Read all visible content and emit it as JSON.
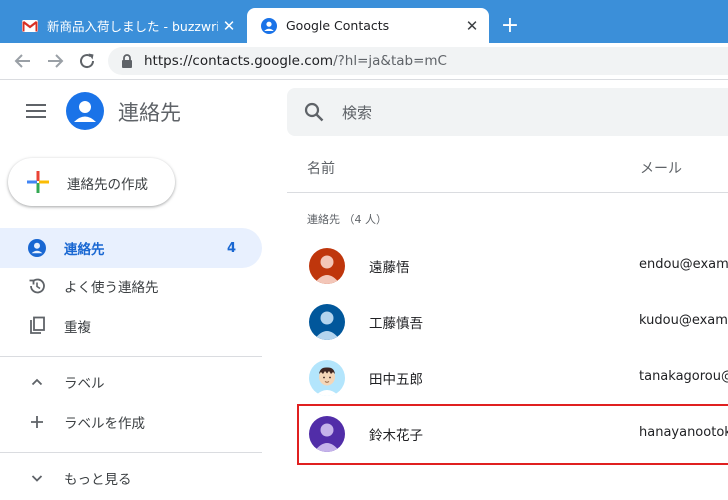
{
  "browser": {
    "tabs": [
      {
        "title": "新商品入荷しました - buzzwriter.zz",
        "icon": "gmail-icon",
        "close": "✕"
      },
      {
        "title": "Google Contacts",
        "icon": "contacts-icon",
        "close": "✕"
      }
    ],
    "new_tab": "+",
    "url_host": "https://contacts.google.com",
    "url_rest": "/?hl=ja&tab=mC"
  },
  "app": {
    "title": "連絡先",
    "search_placeholder": "検索",
    "create_label": "連絡先の作成"
  },
  "sidebar": {
    "items": [
      {
        "label": "連絡先",
        "count": "4",
        "icon": "person-icon",
        "active": true
      },
      {
        "label": "よく使う連絡先",
        "icon": "history-icon"
      },
      {
        "label": "重複",
        "icon": "duplicate-icon"
      },
      {
        "label": "ラベル",
        "icon": "chevron-up-icon"
      },
      {
        "label": "ラベルを作成",
        "icon": "plus-icon"
      },
      {
        "label": "もっと見る",
        "icon": "chevron-down-icon"
      }
    ]
  },
  "list": {
    "col_name": "名前",
    "col_email": "メール",
    "group": "連絡先 （4 人）",
    "contacts": [
      {
        "name": "遠藤悟",
        "email": "endou@examp",
        "avatar_color": "#bf360c"
      },
      {
        "name": "工藤慎吾",
        "email": "kudou@examp",
        "avatar_color": "#01579b"
      },
      {
        "name": "田中五郎",
        "email": "tanakagorou@",
        "avatar_color": "#b3e5fc"
      },
      {
        "name": "鈴木花子",
        "email": "hanayanootok",
        "avatar_color": "#512da8",
        "highlighted": true
      }
    ]
  },
  "colors": {
    "tabstrip": "#3b8fd9",
    "accent": "#1a73e8",
    "active_nav": "#e8f0fe",
    "highlight": "#e02020"
  }
}
